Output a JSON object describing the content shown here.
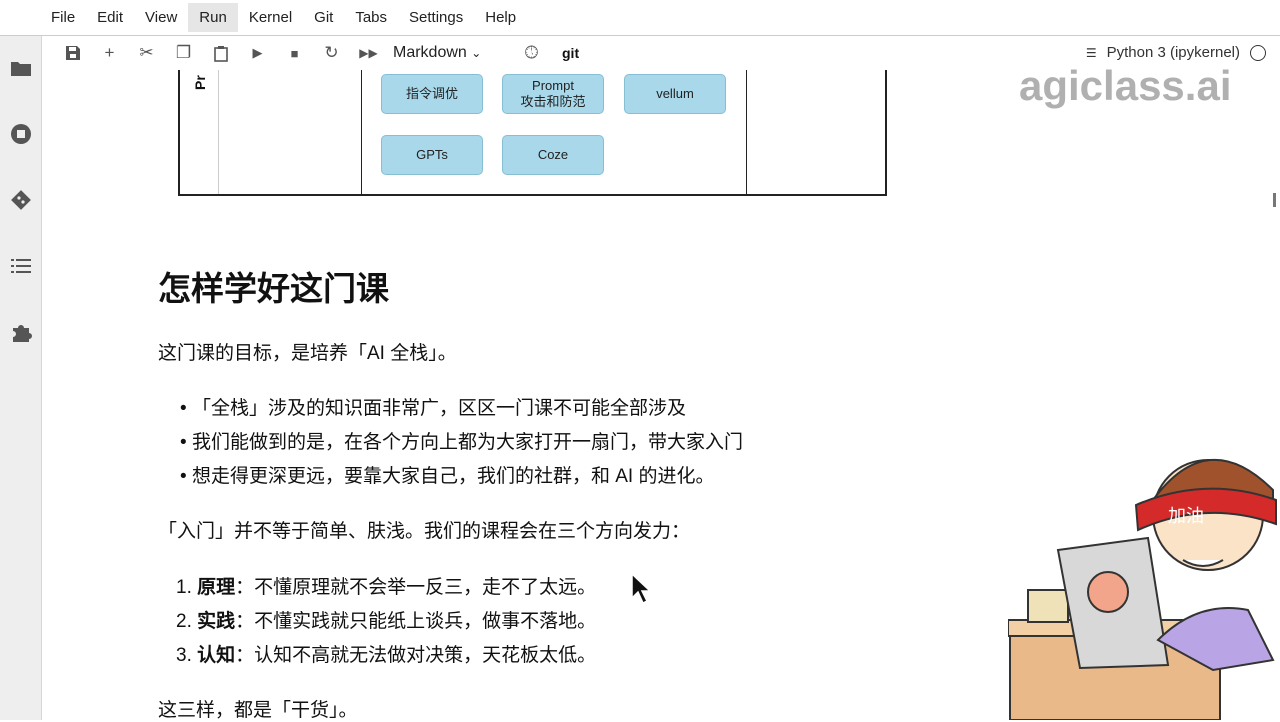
{
  "menu": [
    "File",
    "Edit",
    "View",
    "Run",
    "Kernel",
    "Git",
    "Tabs",
    "Settings",
    "Help"
  ],
  "toolbar": {
    "cell_type": "Markdown",
    "git": "git"
  },
  "kernel": {
    "name": "Python 3 (ipykernel)"
  },
  "watermark": "agiclass.ai",
  "diagram": {
    "vertical_label": "Pr",
    "pills": [
      "指令调优",
      "Prompt\n攻击和防范",
      "vellum",
      "GPTs",
      "Coze"
    ]
  },
  "doc": {
    "heading": "怎样学好这门课",
    "intro": "这门课的目标，是培养「AI 全栈」。",
    "bullets": [
      "「全栈」涉及的知识面非常广，区区一门课不可能全部涉及",
      "我们能做到的是，在各个方向上都为大家打开一扇门，带大家入门",
      "想走得更深更远，要靠大家自己，我们的社群，和 AI 的进化。"
    ],
    "para2": "「入门」并不等于简单、肤浅。我们的课程会在三个方向发力：",
    "numbered": [
      {
        "num": "1.",
        "term": "原理",
        "text": "：不懂原理就不会举一反三，走不了太远。"
      },
      {
        "num": "2.",
        "term": "实践",
        "text": "：不懂实践就只能纸上谈兵，做事不落地。"
      },
      {
        "num": "3.",
        "term": "认知",
        "text": "：认知不高就无法做对决策，天花板太低。"
      }
    ],
    "para3": "这三样，都是「干货」。"
  },
  "cartoon": {
    "headband": "加油"
  }
}
